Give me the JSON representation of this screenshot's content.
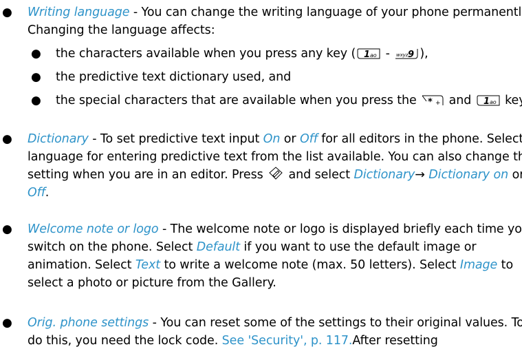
{
  "items": [
    {
      "term": "Writing language",
      "text": " - You can change the writing language of your phone permanently. Changing the language affects:",
      "subitems": [
        {
          "before": "the characters available when you press any key (",
          "key1_icon": "key-1-icon",
          "key1_label": "1",
          "key1_sub": "ao",
          "dash": " - ",
          "key9_icon": "key-9-icon",
          "key9_label": "9",
          "key9_sub": "wxyz",
          "after": "),"
        },
        {
          "text": "the predictive text dictionary used, and"
        },
        {
          "before": "the special characters that are available when you press the ",
          "star_icon": "key-star-icon",
          "star_label": "*",
          "star_sub": "+",
          "mid": " and ",
          "key1_icon": "key-1-icon",
          "key1_label": "1",
          "key1_sub": "ao",
          "after": " keys."
        }
      ]
    },
    {
      "term": "Dictionary",
      "t1": " - To set predictive text input ",
      "opt_on": "On",
      "t2": " or ",
      "opt_off": "Off",
      "t3": " for all editors in the phone. Select a language for entering predictive text from the list available. You can also change this setting when you are in an editor. Press ",
      "pencil_icon": "pencil-key-icon",
      "t4": " and select ",
      "path1": "Dictionary",
      "arrow": "→",
      "path2": " Dictionary on",
      "t5": " or ",
      "path3": "Off",
      "t6": "."
    },
    {
      "term": "Welcome note or logo",
      "t1": " -  The welcome note or logo is displayed briefly each time you switch on the phone. Select ",
      "opt_default": "Default",
      "t2": " if you want to use the default image or animation. Select ",
      "opt_text": "Text",
      "t3": " to write a welcome note (max. 50 letters). Select ",
      "opt_image": "Image",
      "t4": " to select a photo or picture from the Gallery."
    },
    {
      "term": "Orig. phone settings",
      "t1": " - You can reset some of the settings to their original values. To do this, you need the lock code. ",
      "link": "See 'Security', p. 117.",
      "t2": "After resetting"
    }
  ],
  "colors": {
    "accent": "#2e93c9",
    "text": "#000000"
  }
}
